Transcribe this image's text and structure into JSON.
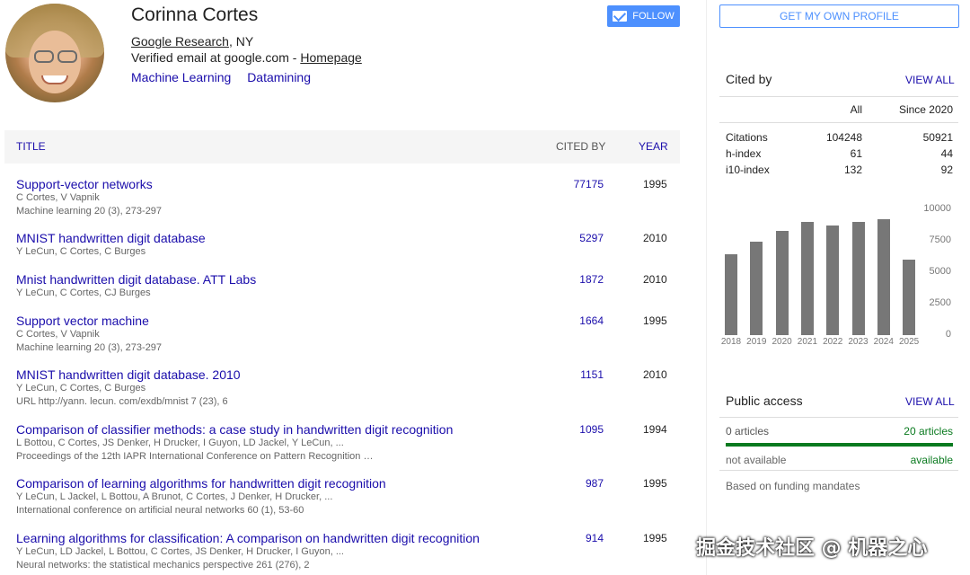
{
  "profile": {
    "name": "Corinna Cortes",
    "affiliation": "Google Research",
    "affiliation_suffix": ", NY",
    "email_prefix": "Verified email at google.com - ",
    "homepage": "Homepage",
    "interests": [
      "Machine Learning",
      "Datamining"
    ],
    "follow_label": "FOLLOW"
  },
  "table": {
    "col_title": "TITLE",
    "col_cited": "CITED BY",
    "col_year": "YEAR",
    "rows": [
      {
        "title": "Support-vector networks",
        "authors": "C Cortes, V Vapnik",
        "venue": "Machine learning 20 (3), 273-297",
        "cited": "77175",
        "year": "1995"
      },
      {
        "title": "MNIST handwritten digit database",
        "authors": "Y LeCun, C Cortes, C Burges",
        "venue": "",
        "cited": "5297",
        "year": "2010"
      },
      {
        "title": "Mnist handwritten digit database. ATT Labs",
        "authors": "Y LeCun, C Cortes, CJ Burges",
        "venue": "",
        "cited": "1872",
        "year": "2010"
      },
      {
        "title": "Support vector machine",
        "authors": "C Cortes, V Vapnik",
        "venue": "Machine learning 20 (3), 273-297",
        "cited": "1664",
        "year": "1995"
      },
      {
        "title": "MNIST handwritten digit database. 2010",
        "authors": "Y LeCun, C Cortes, C Burges",
        "venue": "URL http://yann. lecun. com/exdb/mnist 7 (23), 6",
        "cited": "1151",
        "year": "2010"
      },
      {
        "title": "Comparison of classifier methods: a case study in handwritten digit recognition",
        "authors": "L Bottou, C Cortes, JS Denker, H Drucker, I Guyon, LD Jackel, Y LeCun, ...",
        "venue": "Proceedings of the 12th IAPR International Conference on Pattern Recognition …",
        "cited": "1095",
        "year": "1994"
      },
      {
        "title": "Comparison of learning algorithms for handwritten digit recognition",
        "authors": "Y LeCun, L Jackel, L Bottou, A Brunot, C Cortes, J Denker, H Drucker, ...",
        "venue": "International conference on artificial neural networks 60 (1), 53-60",
        "cited": "987",
        "year": "1995"
      },
      {
        "title": "Learning algorithms for classification: A comparison on handwritten digit recognition",
        "authors": "Y LeCun, LD Jackel, L Bottou, C Cortes, JS Denker, H Drucker, I Guyon, ...",
        "venue": "Neural networks: the statistical mechanics perspective 261 (276), 2",
        "cited": "914",
        "year": "1995"
      }
    ]
  },
  "sidebar": {
    "get_profile": "GET MY OWN PROFILE",
    "cited_by": {
      "title": "Cited by",
      "view_all": "VIEW ALL",
      "col_all": "All",
      "col_since": "Since 2020",
      "rows": [
        {
          "label": "Citations",
          "all": "104248",
          "since": "50921"
        },
        {
          "label": "h-index",
          "all": "61",
          "since": "44"
        },
        {
          "label": "i10-index",
          "all": "132",
          "since": "92"
        }
      ]
    },
    "public_access": {
      "title": "Public access",
      "view_all": "VIEW ALL",
      "left_count": "0 articles",
      "right_count": "20 articles",
      "left_status": "not available",
      "right_status": "available",
      "note": "Based on funding mandates",
      "available_fraction": 1.0,
      "bar_color": "#0a7a1f"
    }
  },
  "chart_data": {
    "type": "bar",
    "categories": [
      "2018",
      "2019",
      "2020",
      "2021",
      "2022",
      "2023",
      "2024",
      "2025"
    ],
    "values": [
      6400,
      7400,
      8300,
      9000,
      8700,
      9000,
      9200,
      6000
    ],
    "ylim": [
      0,
      10000
    ],
    "yticks": [
      "10000",
      "7500",
      "5000",
      "2500",
      "0"
    ],
    "bar_color": "#777777"
  },
  "watermark": "掘金技术社区 @ 机器之心"
}
